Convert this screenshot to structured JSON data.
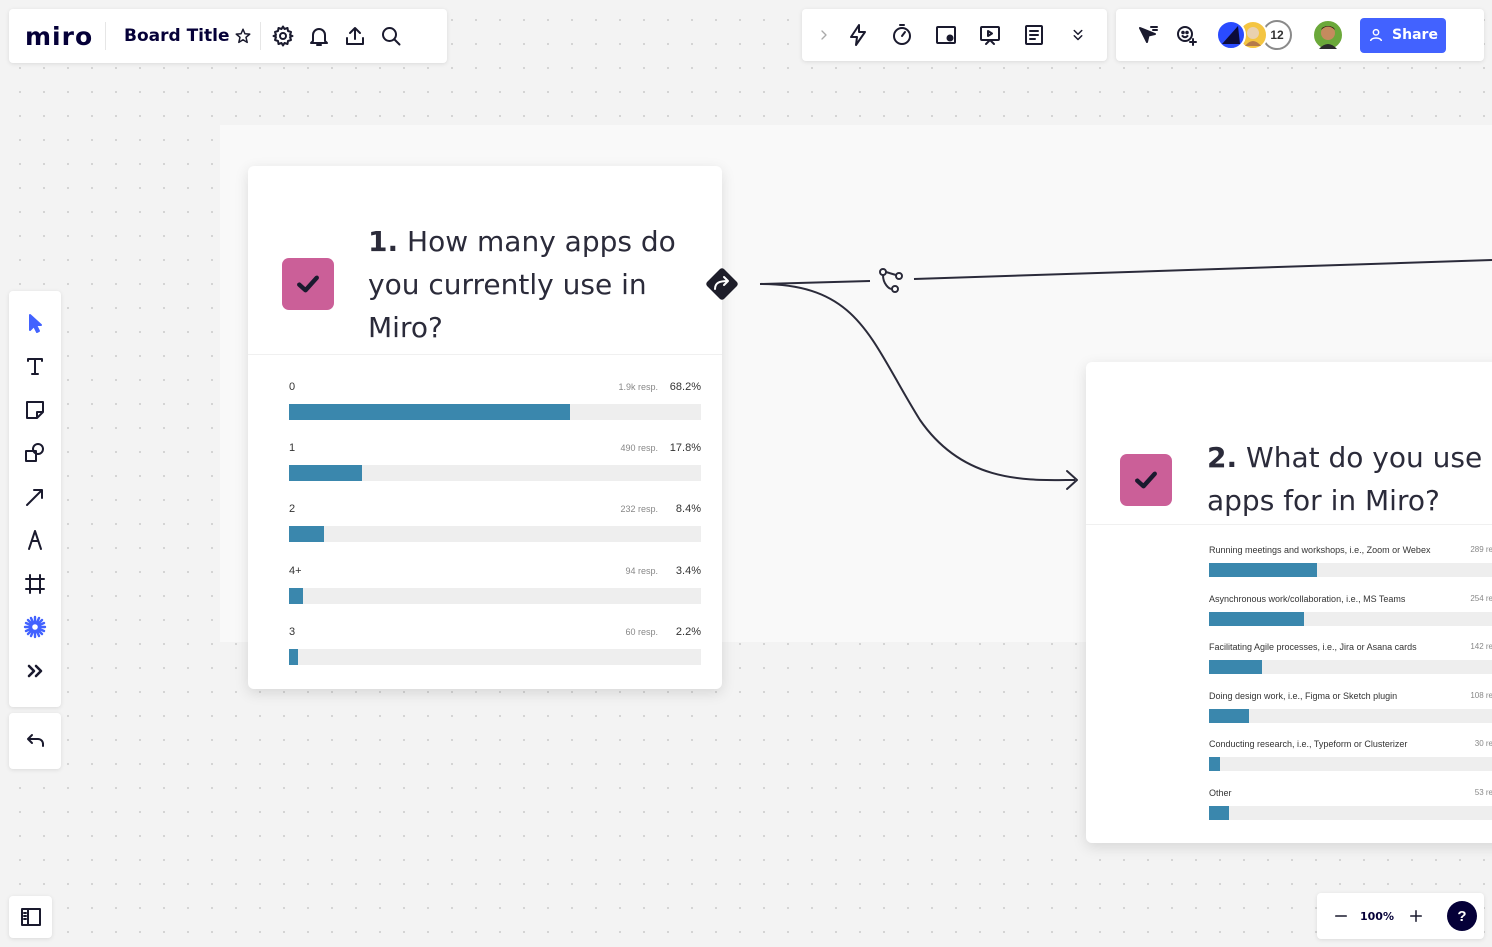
{
  "app": {
    "logo": "miro",
    "board_title": "Board Title"
  },
  "topbar": {
    "left_icons": [
      "star-icon",
      "gear-icon",
      "bell-icon",
      "upload-icon",
      "search-icon"
    ],
    "mid_icons": [
      "chevron-right-icon",
      "lightning-icon",
      "timer-icon",
      "video-icon",
      "present-icon",
      "notes-icon",
      "chevron-double-down-icon"
    ],
    "collab_count": "12",
    "share_label": "Share"
  },
  "colors": {
    "accent": "#4262ff",
    "checkbox": "#cb5f98",
    "bar": "#3a87ad"
  },
  "left_toolbar": [
    "cursor-icon",
    "text-icon",
    "sticky-note-icon",
    "shapes-icon",
    "arrow-icon",
    "pen-icon",
    "frame-icon",
    "apps-icon",
    "more-icon"
  ],
  "zoom": {
    "level": "100%"
  },
  "help": {
    "label": "?"
  },
  "card1": {
    "number": "1.",
    "question": "How many apps do you currently use in Miro?",
    "rows": [
      {
        "label": "0",
        "resp": "1.9k resp.",
        "pct": "68.2%",
        "value": 68.2
      },
      {
        "label": "1",
        "resp": "490 resp.",
        "pct": "17.8%",
        "value": 17.8
      },
      {
        "label": "2",
        "resp": "232 resp.",
        "pct": "8.4%",
        "value": 8.4
      },
      {
        "label": "4+",
        "resp": "94 resp.",
        "pct": "3.4%",
        "value": 3.4
      },
      {
        "label": "3",
        "resp": "60 resp.",
        "pct": "2.2%",
        "value": 2.2
      }
    ]
  },
  "card2": {
    "number": "2.",
    "question": "What do you use apps for in Miro?",
    "rows": [
      {
        "label": "Running meetings and workshops, i.e., Zoom or Webex",
        "resp": "289 re",
        "value": 38
      },
      {
        "label": "Asynchronous work/collaboration, i.e., MS Teams",
        "resp": "254 re",
        "value": 33.5
      },
      {
        "label": "Facilitating Agile processes, i.e., Jira or Asana cards",
        "resp": "142 re",
        "value": 18.7
      },
      {
        "label": "Doing design work, i.e., Figma or Sketch plugin",
        "resp": "108 re",
        "value": 14.2
      },
      {
        "label": "Conducting research, i.e., Typeform or Clusterizer",
        "resp": "30 re",
        "value": 3.9
      },
      {
        "label": "Other",
        "resp": "53 re",
        "value": 7
      }
    ]
  }
}
